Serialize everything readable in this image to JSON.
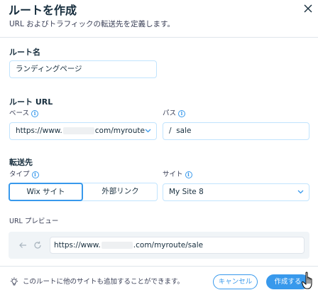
{
  "dialog": {
    "title": "ルートを作成",
    "subtitle": "URL およびトラフィックの転送先を定義します。"
  },
  "route_name": {
    "label": "ルート名",
    "value": "ランディングページ"
  },
  "route_url": {
    "label": "ルート URL",
    "base_label": "ベース",
    "base_value_prefix": "https://www.",
    "base_value_suffix": "com/myroute",
    "path_label": "パス",
    "path_value": "/  sale"
  },
  "destination": {
    "label": "転送先",
    "type_label": "タイプ",
    "type_options": [
      "Wix サイト",
      "外部リンク"
    ],
    "selected_type": "Wix サイト",
    "site_label": "サイト",
    "site_value": "My Site 8"
  },
  "preview": {
    "label": "URL プレビュー",
    "url_prefix": "https://www.",
    "url_suffix": ".com/myroute/sale"
  },
  "footer": {
    "tip": "このルートに他のサイトも追加することができます。",
    "cancel_label": "キャンセル",
    "create_label": "作成する"
  },
  "colors": {
    "accent": "#3899ec",
    "field_border": "#c1e4fe",
    "preview_bg": "#f0f4f7",
    "text": "#162d3d"
  },
  "icons": {
    "close": "close-icon",
    "info": "info-icon",
    "chevron": "chevron-down-icon",
    "back": "arrow-left-icon",
    "refresh": "refresh-icon",
    "tip": "lightbulb-icon"
  }
}
